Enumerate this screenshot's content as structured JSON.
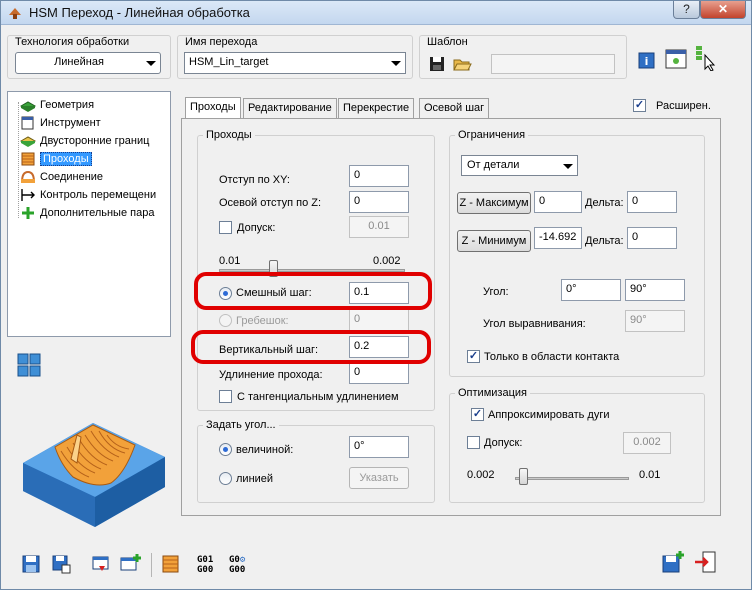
{
  "window": {
    "title": "HSM Переход - Линейная обработка"
  },
  "titlebar": {
    "help_label": "?",
    "close_label": "✕"
  },
  "top": {
    "tech_label": "Технология обработки",
    "tech_value": "Линейная",
    "name_label": "Имя перехода",
    "name_value": "HSM_Lin_target",
    "template_label": "Шаблон",
    "template_value": ""
  },
  "tree": {
    "items": [
      {
        "label": "Геометрия",
        "icon": "geometry-icon"
      },
      {
        "label": "Инструмент",
        "icon": "tool-icon"
      },
      {
        "label": "Двусторонние границ",
        "icon": "bounds-icon"
      },
      {
        "label": "Проходы",
        "icon": "passes-icon",
        "selected": true
      },
      {
        "label": "Соединение",
        "icon": "link-icon"
      },
      {
        "label": "Контроль перемещени",
        "icon": "motion-control-icon"
      },
      {
        "label": "Дополнительные пара",
        "icon": "add-params-icon"
      }
    ]
  },
  "tabs": [
    {
      "label": "Проходы",
      "active": true
    },
    {
      "label": "Редактирование"
    },
    {
      "label": "Перекрестие"
    },
    {
      "label": "Осевой шаг"
    }
  ],
  "extended": {
    "label": "Расширен.",
    "checked": true
  },
  "passes": {
    "title": "Проходы",
    "offset_xy_label": "Отступ по XY:",
    "offset_xy_value": "0",
    "offset_z_label": "Осевой отступ по Z:",
    "offset_z_value": "0",
    "tolerance_label": "Допуск:",
    "tolerance_value": "0.01",
    "slider_min": "0.01",
    "slider_max": "0.002",
    "mixed_step_label": "Смешный шаг:",
    "mixed_step_value": "0.1",
    "scallop_label": "Гребешок:",
    "scallop_value": "0",
    "vertical_step_label": "Вертикальный шаг:",
    "vertical_step_value": "0.2",
    "extension_label": "Удлинение прохода:",
    "extension_value": "0",
    "tangent_label": "С тангенциальным удлинением"
  },
  "angle": {
    "title": "Задать угол...",
    "by_value_label": "величиной:",
    "by_value_value": "0°",
    "by_line_label": "линией",
    "pick_label": "Указать"
  },
  "limits": {
    "title": "Ограничения",
    "mode_value": "От детали",
    "zmax_label": "Z - Максимум",
    "zmax_value": "0",
    "delta1_label": "Дельта:",
    "delta1_value": "0",
    "zmin_label": "Z - Минимум",
    "zmin_value": "-14.692",
    "delta2_label": "Дельта:",
    "delta2_value": "0",
    "angle_label": "Угол:",
    "angle_from": "0°",
    "angle_to": "90°",
    "align_angle_label": "Угол выравнивания:",
    "align_angle_value": "90°",
    "contact_only_label": "Только в области контакта"
  },
  "optimization": {
    "title": "Оптимизация",
    "approx_arcs_label": "Аппроксимировать дуги",
    "tolerance_label": "Допуск:",
    "tolerance_value": "0.002",
    "slider_min": "0.002",
    "slider_max": "0.01"
  },
  "bottom": {
    "gcode1_top": "G01",
    "gcode1_bottom": "G00",
    "gcode2_top": "G0",
    "gcode2_bottom": "G00"
  },
  "colors": {
    "highlight": "#e00000",
    "selection": "#3399ff",
    "accent_orange": "#f2a13a",
    "model_blue": "#3f8fd6"
  }
}
